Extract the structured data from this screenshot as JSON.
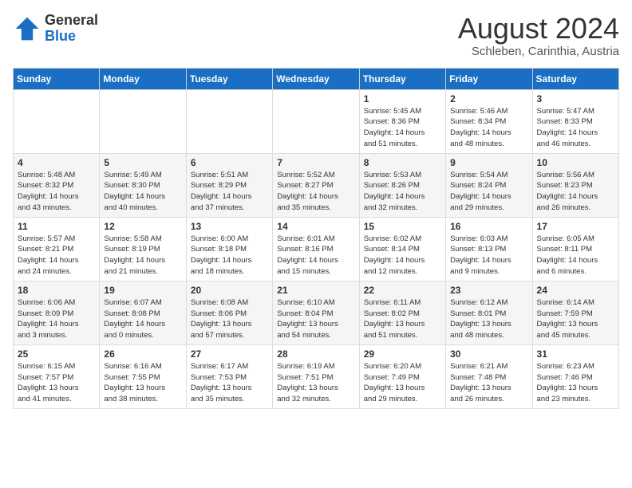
{
  "header": {
    "logo": {
      "general": "General",
      "blue": "Blue"
    },
    "title": "August 2024",
    "location": "Schleben, Carinthia, Austria"
  },
  "weekdays": [
    "Sunday",
    "Monday",
    "Tuesday",
    "Wednesday",
    "Thursday",
    "Friday",
    "Saturday"
  ],
  "weeks": [
    [
      {
        "day": "",
        "info": ""
      },
      {
        "day": "",
        "info": ""
      },
      {
        "day": "",
        "info": ""
      },
      {
        "day": "",
        "info": ""
      },
      {
        "day": "1",
        "info": "Sunrise: 5:45 AM\nSunset: 8:36 PM\nDaylight: 14 hours\nand 51 minutes."
      },
      {
        "day": "2",
        "info": "Sunrise: 5:46 AM\nSunset: 8:34 PM\nDaylight: 14 hours\nand 48 minutes."
      },
      {
        "day": "3",
        "info": "Sunrise: 5:47 AM\nSunset: 8:33 PM\nDaylight: 14 hours\nand 46 minutes."
      }
    ],
    [
      {
        "day": "4",
        "info": "Sunrise: 5:48 AM\nSunset: 8:32 PM\nDaylight: 14 hours\nand 43 minutes."
      },
      {
        "day": "5",
        "info": "Sunrise: 5:49 AM\nSunset: 8:30 PM\nDaylight: 14 hours\nand 40 minutes."
      },
      {
        "day": "6",
        "info": "Sunrise: 5:51 AM\nSunset: 8:29 PM\nDaylight: 14 hours\nand 37 minutes."
      },
      {
        "day": "7",
        "info": "Sunrise: 5:52 AM\nSunset: 8:27 PM\nDaylight: 14 hours\nand 35 minutes."
      },
      {
        "day": "8",
        "info": "Sunrise: 5:53 AM\nSunset: 8:26 PM\nDaylight: 14 hours\nand 32 minutes."
      },
      {
        "day": "9",
        "info": "Sunrise: 5:54 AM\nSunset: 8:24 PM\nDaylight: 14 hours\nand 29 minutes."
      },
      {
        "day": "10",
        "info": "Sunrise: 5:56 AM\nSunset: 8:23 PM\nDaylight: 14 hours\nand 26 minutes."
      }
    ],
    [
      {
        "day": "11",
        "info": "Sunrise: 5:57 AM\nSunset: 8:21 PM\nDaylight: 14 hours\nand 24 minutes."
      },
      {
        "day": "12",
        "info": "Sunrise: 5:58 AM\nSunset: 8:19 PM\nDaylight: 14 hours\nand 21 minutes."
      },
      {
        "day": "13",
        "info": "Sunrise: 6:00 AM\nSunset: 8:18 PM\nDaylight: 14 hours\nand 18 minutes."
      },
      {
        "day": "14",
        "info": "Sunrise: 6:01 AM\nSunset: 8:16 PM\nDaylight: 14 hours\nand 15 minutes."
      },
      {
        "day": "15",
        "info": "Sunrise: 6:02 AM\nSunset: 8:14 PM\nDaylight: 14 hours\nand 12 minutes."
      },
      {
        "day": "16",
        "info": "Sunrise: 6:03 AM\nSunset: 8:13 PM\nDaylight: 14 hours\nand 9 minutes."
      },
      {
        "day": "17",
        "info": "Sunrise: 6:05 AM\nSunset: 8:11 PM\nDaylight: 14 hours\nand 6 minutes."
      }
    ],
    [
      {
        "day": "18",
        "info": "Sunrise: 6:06 AM\nSunset: 8:09 PM\nDaylight: 14 hours\nand 3 minutes."
      },
      {
        "day": "19",
        "info": "Sunrise: 6:07 AM\nSunset: 8:08 PM\nDaylight: 14 hours\nand 0 minutes."
      },
      {
        "day": "20",
        "info": "Sunrise: 6:08 AM\nSunset: 8:06 PM\nDaylight: 13 hours\nand 57 minutes."
      },
      {
        "day": "21",
        "info": "Sunrise: 6:10 AM\nSunset: 8:04 PM\nDaylight: 13 hours\nand 54 minutes."
      },
      {
        "day": "22",
        "info": "Sunrise: 6:11 AM\nSunset: 8:02 PM\nDaylight: 13 hours\nand 51 minutes."
      },
      {
        "day": "23",
        "info": "Sunrise: 6:12 AM\nSunset: 8:01 PM\nDaylight: 13 hours\nand 48 minutes."
      },
      {
        "day": "24",
        "info": "Sunrise: 6:14 AM\nSunset: 7:59 PM\nDaylight: 13 hours\nand 45 minutes."
      }
    ],
    [
      {
        "day": "25",
        "info": "Sunrise: 6:15 AM\nSunset: 7:57 PM\nDaylight: 13 hours\nand 41 minutes."
      },
      {
        "day": "26",
        "info": "Sunrise: 6:16 AM\nSunset: 7:55 PM\nDaylight: 13 hours\nand 38 minutes."
      },
      {
        "day": "27",
        "info": "Sunrise: 6:17 AM\nSunset: 7:53 PM\nDaylight: 13 hours\nand 35 minutes."
      },
      {
        "day": "28",
        "info": "Sunrise: 6:19 AM\nSunset: 7:51 PM\nDaylight: 13 hours\nand 32 minutes."
      },
      {
        "day": "29",
        "info": "Sunrise: 6:20 AM\nSunset: 7:49 PM\nDaylight: 13 hours\nand 29 minutes."
      },
      {
        "day": "30",
        "info": "Sunrise: 6:21 AM\nSunset: 7:48 PM\nDaylight: 13 hours\nand 26 minutes."
      },
      {
        "day": "31",
        "info": "Sunrise: 6:23 AM\nSunset: 7:46 PM\nDaylight: 13 hours\nand 23 minutes."
      }
    ]
  ]
}
